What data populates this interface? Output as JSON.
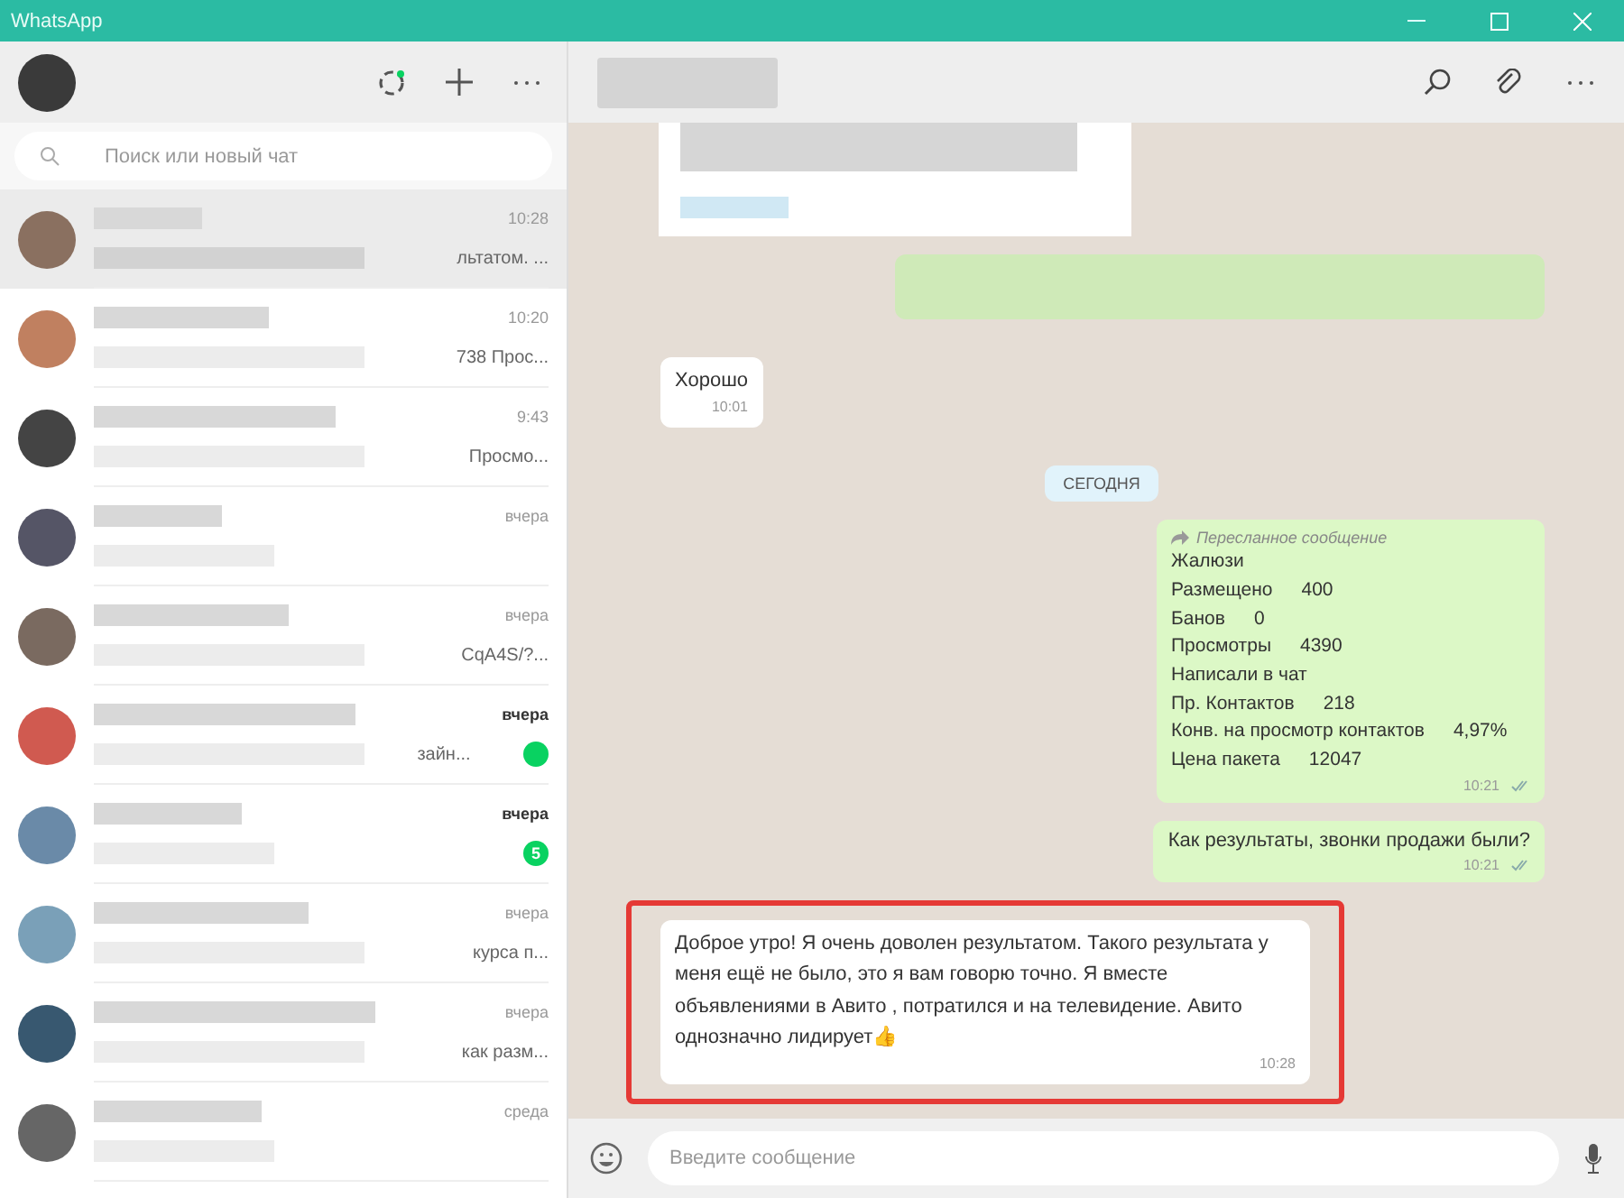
{
  "window": {
    "title": "WhatsApp"
  },
  "search": {
    "placeholder": "Поиск или новый чат"
  },
  "chats": [
    {
      "time": "10:28",
      "preview": "льтатом. ...",
      "selected": true,
      "unread": false
    },
    {
      "time": "10:20",
      "preview": "738 Прос...",
      "selected": false,
      "unread": false
    },
    {
      "time": "9:43",
      "preview": "Просмо...",
      "selected": false,
      "unread": false
    },
    {
      "time": "вчера",
      "selected": false,
      "unread": false
    },
    {
      "time": "вчера",
      "preview": "CqA4S/?...",
      "selected": false,
      "unread": false
    },
    {
      "time": "вчера",
      "preview": "зайн...",
      "selected": false,
      "unread": true
    },
    {
      "time": "вчера",
      "selected": false,
      "unread": true,
      "badge": "5"
    },
    {
      "time": "вчера",
      "preview": "курса п...",
      "selected": false,
      "unread": false
    },
    {
      "time": "вчера",
      "preview": "как разм...",
      "selected": false,
      "unread": false
    },
    {
      "time": "среда",
      "selected": false,
      "unread": false
    }
  ],
  "messages": [
    {
      "kind": "blurred-card"
    },
    {
      "kind": "blurred-outgoing"
    },
    {
      "kind": "incoming",
      "text": "Хорошо",
      "time": "10:01",
      "highlighted": false
    },
    {
      "kind": "date",
      "text": "СЕГОДНЯ"
    },
    {
      "kind": "forwarded",
      "label": "Пересланное сообщение",
      "time": "10:21",
      "lines": [
        {
          "label": "Жалюзи"
        },
        {
          "label": "Размещено",
          "value": "400"
        },
        {
          "label": "Банов",
          "value": "0"
        },
        {
          "label": "Просмотры",
          "value": "4390"
        },
        {
          "label": "Написали в чат"
        },
        {
          "label": "Пр. Контактов",
          "value": "218"
        },
        {
          "label": "Конв. на просмотр контактов",
          "value": "4,97%"
        },
        {
          "label": "Цена пакета",
          "value": "12047"
        }
      ]
    },
    {
      "kind": "outgoing",
      "text": "Как результаты, звонки продажи были?",
      "time": "10:21"
    },
    {
      "kind": "incoming",
      "text": "Доброе утро! Я очень доволен результатом. Такого результата у меня ещё не было, это я вам говорю точно. Я вместе объявлениями в Авито , потратился и на телевидение. Авито однозначно лидирует👍",
      "time": "10:28",
      "highlighted": true
    }
  ],
  "composer": {
    "placeholder": "Введите сообщение"
  }
}
